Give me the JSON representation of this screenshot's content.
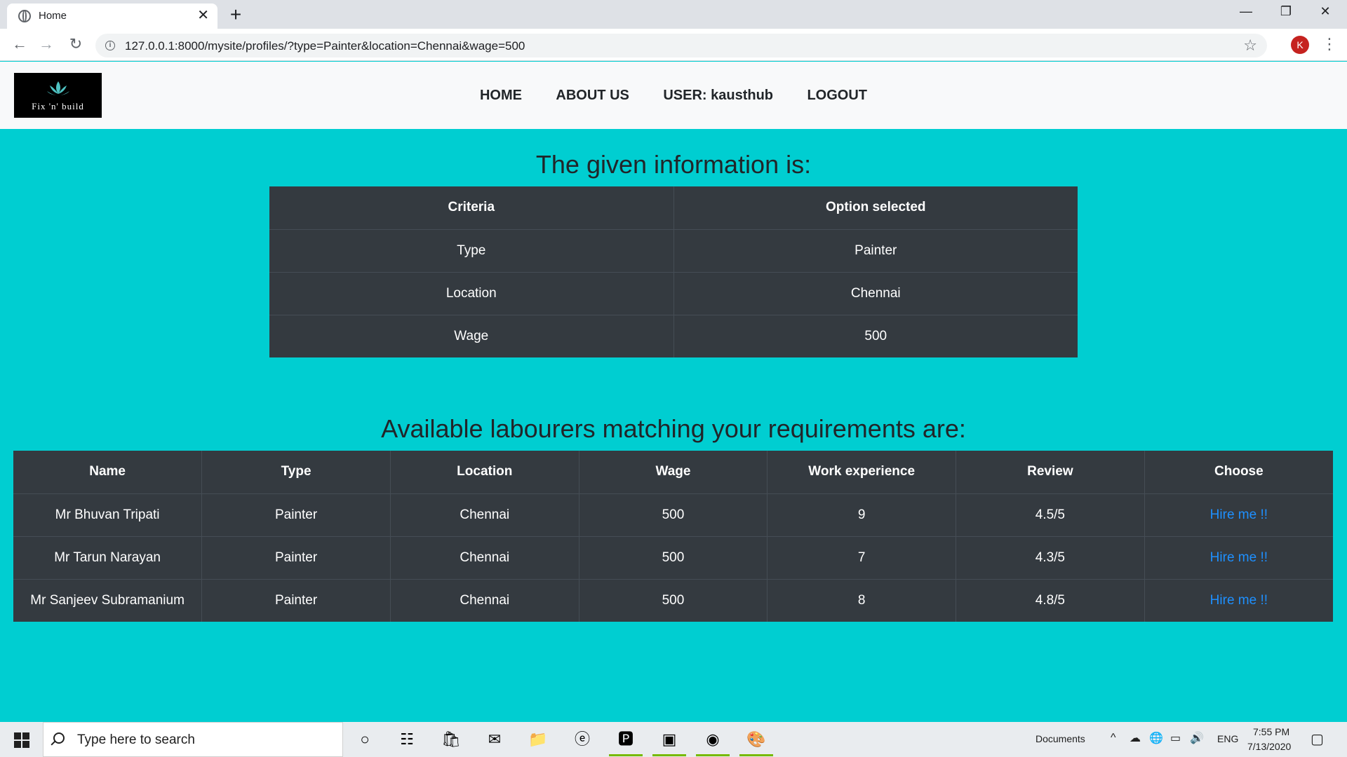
{
  "browser": {
    "tab_title": "Home",
    "url": "127.0.0.1:8000/mysite/profiles/?type=Painter&location=Chennai&wage=500",
    "profile_initial": "K"
  },
  "nav": {
    "logo_text": "Fix 'n' build",
    "links": [
      "HOME",
      "ABOUT US",
      "USER: kausthub",
      "LOGOUT"
    ]
  },
  "given": {
    "heading": "The given information is:",
    "headers": [
      "Criteria",
      "Option selected"
    ],
    "rows": [
      [
        "Type",
        "Painter"
      ],
      [
        "Location",
        "Chennai"
      ],
      [
        "Wage",
        "500"
      ]
    ]
  },
  "labourers": {
    "heading": "Available labourers matching your requirements are:",
    "headers": [
      "Name",
      "Type",
      "Location",
      "Wage",
      "Work experience",
      "Review",
      "Choose"
    ],
    "rows": [
      [
        "Mr Bhuvan Tripati",
        "Painter",
        "Chennai",
        "500",
        "9",
        "4.5/5",
        "Hire me !!"
      ],
      [
        "Mr Tarun Narayan",
        "Painter",
        "Chennai",
        "500",
        "7",
        "4.3/5",
        "Hire me !!"
      ],
      [
        "Mr Sanjeev Subramanium",
        "Painter",
        "Chennai",
        "500",
        "8",
        "4.8/5",
        "Hire me !!"
      ]
    ]
  },
  "taskbar": {
    "search_placeholder": "Type here to search",
    "documents_label": "Documents",
    "language": "ENG",
    "time": "7:55 PM",
    "date": "7/13/2020"
  },
  "colors": {
    "page_background": "#00ced1",
    "table_background": "#343a40",
    "link": "#1e90ff"
  }
}
